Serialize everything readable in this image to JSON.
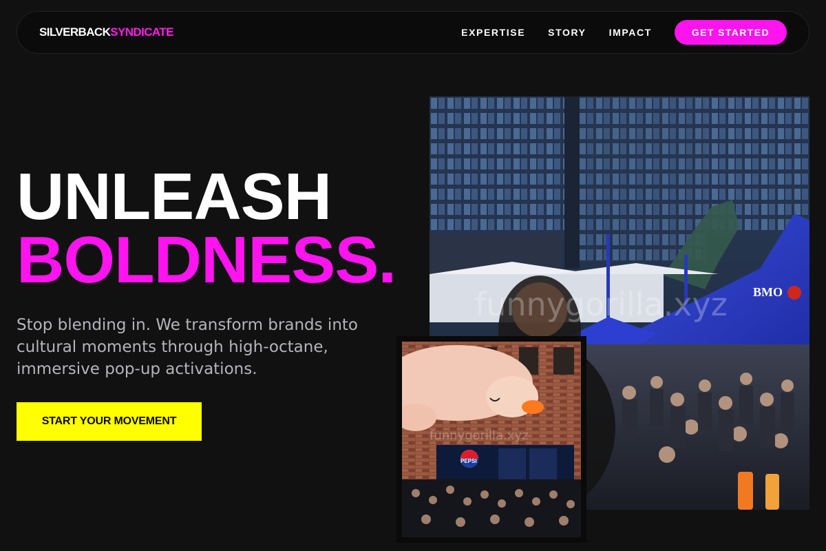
{
  "brand": {
    "name_part1": "SILVERBACK",
    "name_part2": "SYNDICATE",
    "color_primary": "#ffffff",
    "color_accent": "#ff14f0"
  },
  "nav": {
    "links": [
      {
        "label": "EXPERTISE"
      },
      {
        "label": "STORY"
      },
      {
        "label": "IMPACT"
      }
    ],
    "cta_label": "GET STARTED"
  },
  "hero": {
    "headline_line1": "UNLEASH",
    "headline_line2": "BOLDNESS.",
    "subheading": "Stop blending in. We transform brands into cultural moments through high-octane, immersive pop-up activations.",
    "cta_label": "START YOUR MOVEMENT",
    "cta_color": "#ffff00"
  },
  "images": {
    "main": {
      "tent_sign": "BMO",
      "watermark": "funnygorilla.xyz"
    },
    "secondary": {
      "booth_sign": "PEPSI",
      "watermark": "funnygorilla.xyz"
    }
  },
  "colors": {
    "background": "#111112",
    "nav_bg": "#0b0b0c",
    "muted_text": "#b4b4bc"
  }
}
